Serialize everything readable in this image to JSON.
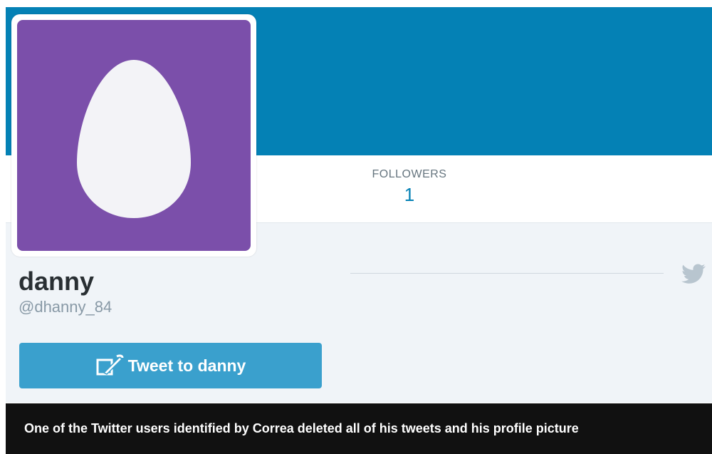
{
  "colors": {
    "banner": "#0481b5",
    "avatar": "#7b4faa",
    "button": "#3aa0cd",
    "caption_bg": "#111111"
  },
  "stats": {
    "followers_label": "FOLLOWERS",
    "followers_count": "1"
  },
  "profile": {
    "name": "danny",
    "handle": "@dhanny_84",
    "avatar_icon": "egg-icon"
  },
  "actions": {
    "tweet_to_label": "Tweet to danny",
    "tweet_to_icon": "compose-tweet-icon"
  },
  "decor": {
    "bird_icon": "twitter-bird-icon"
  },
  "caption": {
    "text": "One of the Twitter users identified by Correa deleted all of his tweets and his profile picture"
  }
}
